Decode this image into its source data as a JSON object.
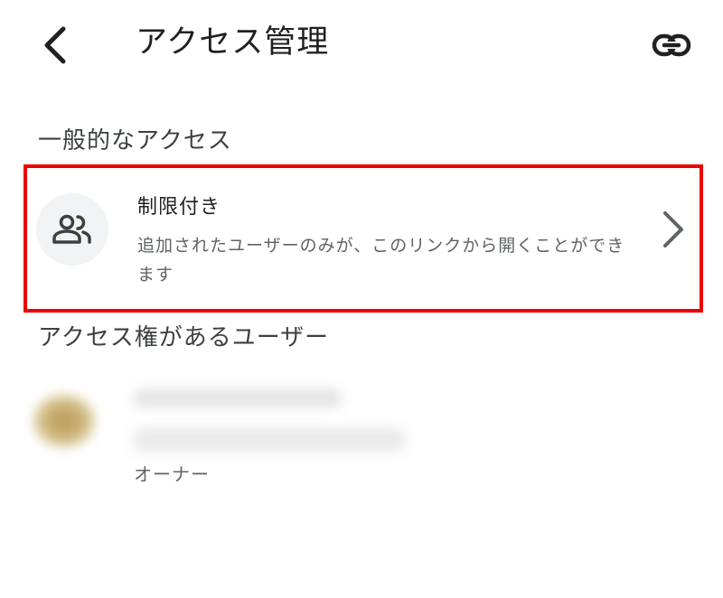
{
  "appbar": {
    "title": "アクセス管理",
    "back_icon": "arrow-back-icon",
    "link_icon": "link-icon"
  },
  "general_access": {
    "header": "一般的なアクセス",
    "option": {
      "title": "制限付き",
      "description": "追加されたユーザーのみが、このリンクから開くことができます",
      "icon": "people-icon",
      "chevron_icon": "chevron-right-icon"
    }
  },
  "users_with_access": {
    "header": "アクセス権があるユーザー",
    "users": [
      {
        "name": "",
        "email": "",
        "role": "オーナー"
      }
    ]
  },
  "colors": {
    "highlight_border": "#ee0000",
    "primary_text": "#202124",
    "secondary_text": "#5f6368",
    "icon_bg": "#f1f3f4"
  }
}
